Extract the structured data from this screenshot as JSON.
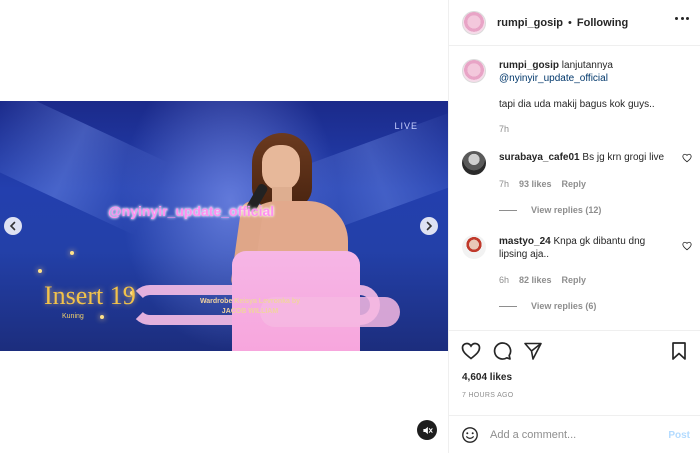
{
  "header": {
    "username": "rumpi_gosip",
    "separator": "•",
    "follow_status": "Following",
    "more_icon": "more-horizontal-icon"
  },
  "video": {
    "watermark": "@nyinyir_update_official",
    "live_label": "LIVE",
    "show_logo": "Insert 19",
    "show_logo_sub": "Kuning",
    "credit_line1": "Wardrobe Keisya Levronka by",
    "credit_line2": "JACOB WILLIAM",
    "mute_icon": "speaker-muted-icon"
  },
  "caption": {
    "username": "rumpi_gosip",
    "text_line1": "lanjutannya",
    "mention": "@nyinyir_update_official",
    "text_line2": "tapi dia uda makij bagus kok guys..",
    "time": "7h"
  },
  "comments": [
    {
      "username": "surabaya_cafe01",
      "text": "Bs jg krn grogi live",
      "time": "7h",
      "likes": "93 likes",
      "reply_label": "Reply",
      "view_replies": "View replies (12)"
    },
    {
      "username": "mastyo_24",
      "text": "Knpa gk dibantu dng lipsing aja..",
      "time": "6h",
      "likes": "82 likes",
      "reply_label": "Reply",
      "view_replies": "View replies (6)"
    }
  ],
  "actions": {
    "likes": "4,604 likes",
    "time_ago": "7 HOURS AGO",
    "comment_placeholder": "Add a comment...",
    "post_label": "Post"
  },
  "colors": {
    "link_blue": "#00376b",
    "muted_gray": "#8e8e8e",
    "post_button_disabled": "#b3dbff"
  }
}
